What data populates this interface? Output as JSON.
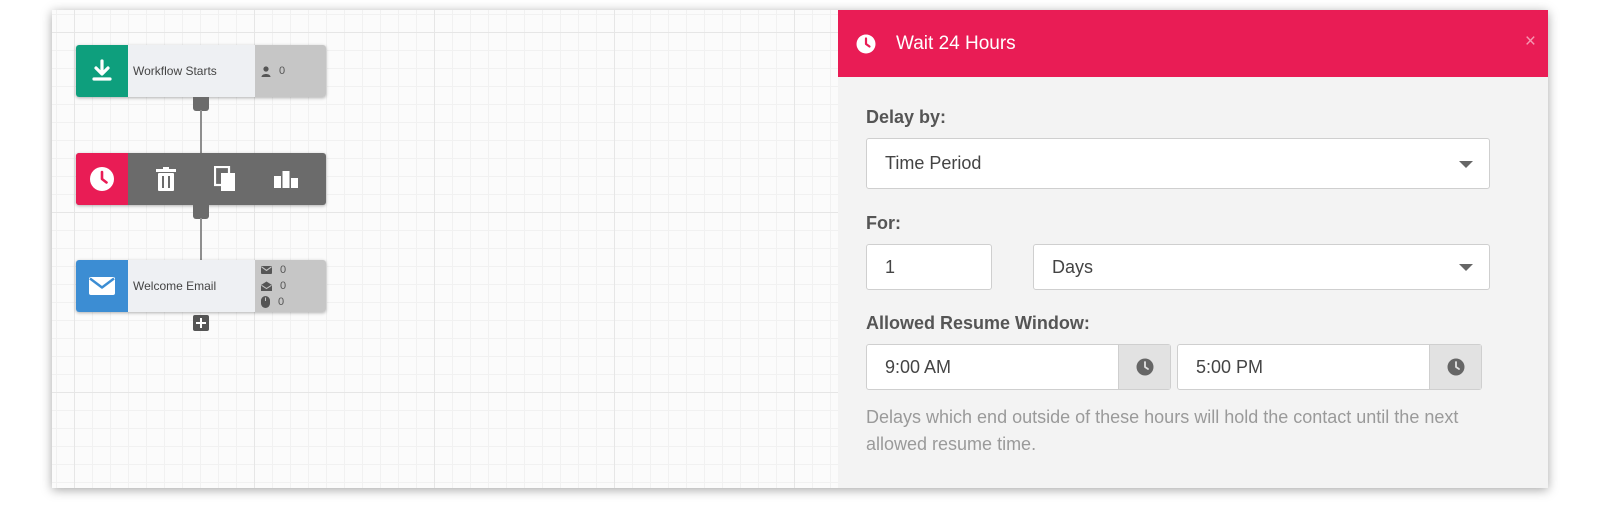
{
  "workflow": {
    "start_node": {
      "label": "Workflow Starts",
      "contacts_count": "0",
      "icon": "download-arrow-icon",
      "color": "#0e9f7d"
    },
    "wait_node": {
      "icon": "clock-icon",
      "color": "#e91c55",
      "actions": [
        "trash-icon",
        "copy-icon",
        "bar-chart-icon"
      ]
    },
    "email_node": {
      "label": "Welcome Email",
      "sent_count": "0",
      "opened_count": "0",
      "clicked_count": "0",
      "icon": "envelope-icon",
      "color": "#3c8dd3"
    }
  },
  "panel": {
    "title": "Wait 24 Hours",
    "close_label": "×",
    "delay_by_label": "Delay by:",
    "delay_by_value": "Time Period",
    "for_label": "For:",
    "for_amount": "1",
    "for_unit": "Days",
    "resume_window_label": "Allowed Resume Window:",
    "resume_start": "9:00 AM",
    "resume_end": "5:00 PM",
    "help_text": "Delays which end outside of these hours will hold the contact until the next allowed resume time.",
    "header_color": "#e91c55"
  }
}
